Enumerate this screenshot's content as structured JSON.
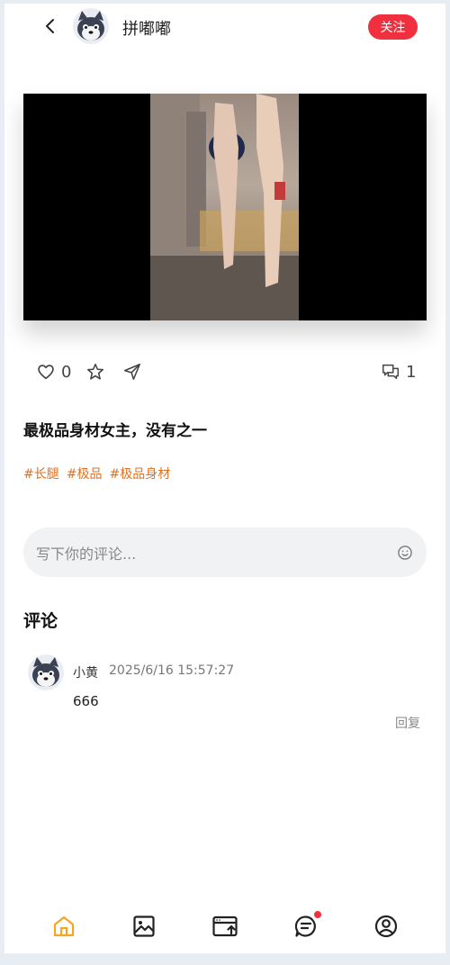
{
  "header": {
    "username": "拼嘟嘟",
    "follow_label": "关注"
  },
  "post": {
    "likes": "0",
    "comments_count": "1",
    "title": "最极品身材女主，没有之一",
    "tags": [
      "#长腿",
      "#极品",
      "#极品身材"
    ]
  },
  "comment_box": {
    "placeholder": "写下你的评论..."
  },
  "comments_section": {
    "title": "评论",
    "items": [
      {
        "user": "小黄",
        "time": "2025/6/16 15:57:27",
        "text": "666",
        "reply_label": "回复"
      }
    ]
  },
  "tabbar": {
    "active_color": "#f5a623",
    "items": [
      "home-icon",
      "image-icon",
      "upload-icon",
      "message-icon",
      "profile-icon"
    ]
  },
  "colors": {
    "accent_red": "#f0303f",
    "tag_orange": "#e07020"
  }
}
